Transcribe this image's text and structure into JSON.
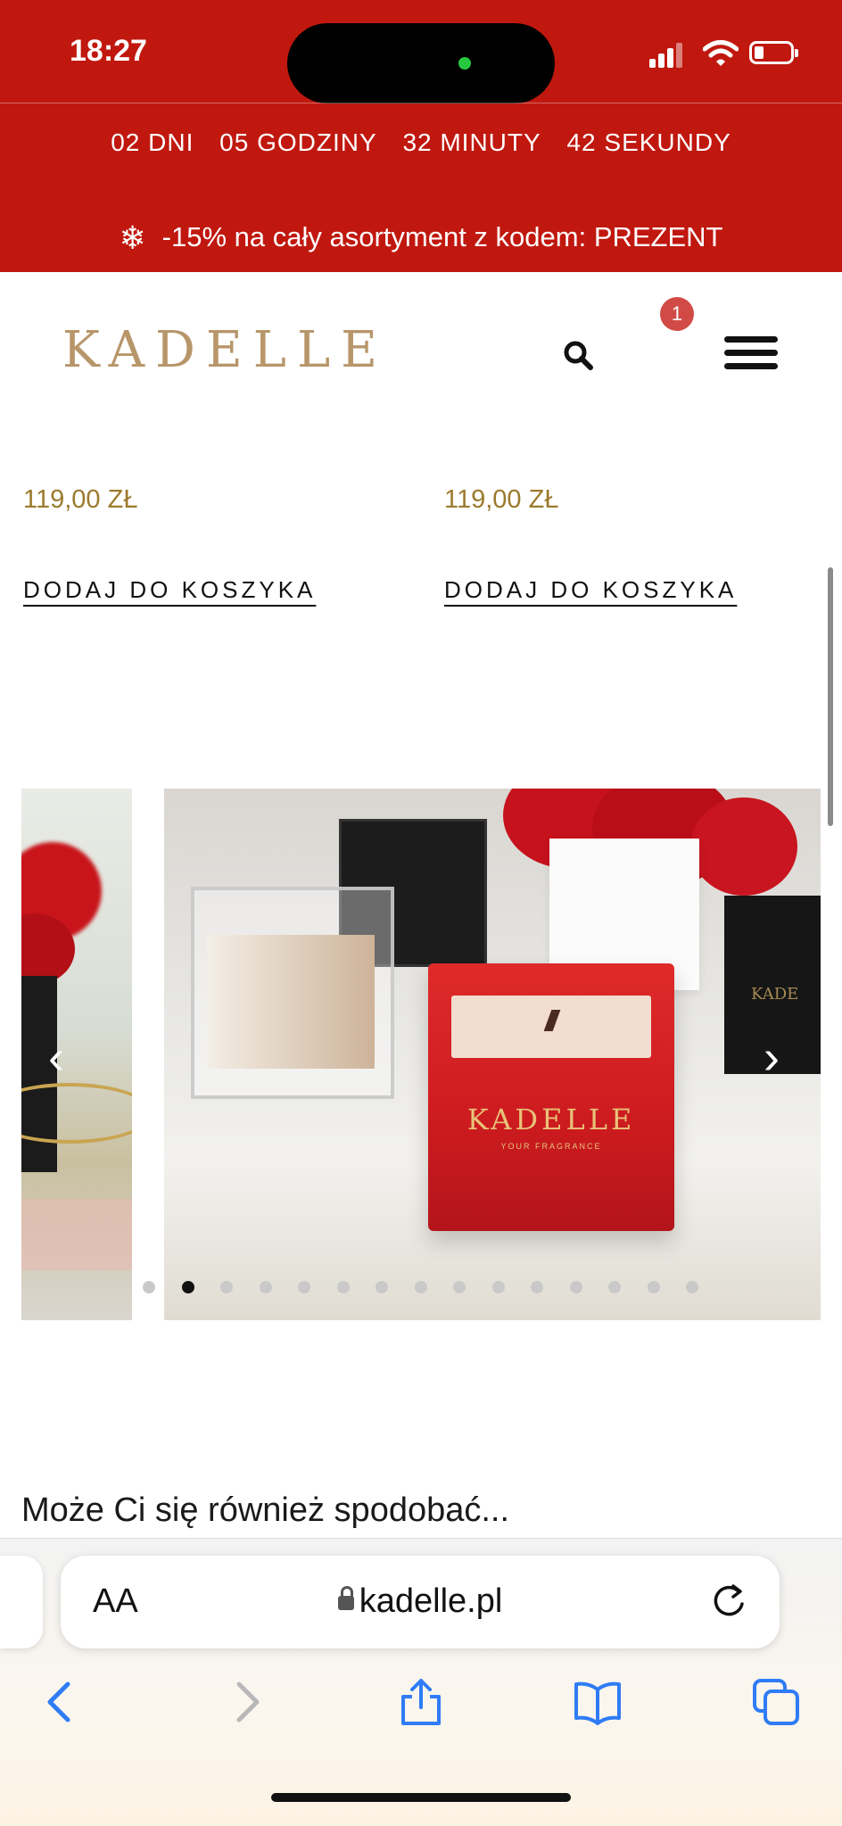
{
  "status_bar": {
    "time": "18:27",
    "icons": [
      "signal-icon",
      "wifi-icon",
      "battery-icon"
    ]
  },
  "countdown": {
    "days": "02 DNI",
    "hours": "05 GODZINY",
    "minutes": "32 MINUTY",
    "seconds": "42 SEKUNDY"
  },
  "promo": {
    "icon": "snowflake-icon",
    "text": "-15% na cały asortyment z kodem: PREZENT"
  },
  "header": {
    "logo": "KADELLE",
    "cart_count": "1",
    "icons": [
      "search-icon",
      "menu-icon"
    ]
  },
  "products": [
    {
      "price": "119,00 ZŁ",
      "add_to_cart": "DODAJ DO KOSZYKA"
    },
    {
      "price": "119,00 ZŁ",
      "add_to_cart": "DODAJ DO KOSZYKA"
    }
  ],
  "slider": {
    "prev_icon": "chevron-left-icon",
    "next_icon": "chevron-right-icon",
    "candle_label": "KADELLE",
    "candle_sublabel": "YOUR FRAGRANCE",
    "dot_count": 15,
    "active_dot": 1
  },
  "recommendations": {
    "title": "Może Ci się również spodobać..."
  },
  "browser": {
    "text_size_label": "AA",
    "url": "kadelle.pl",
    "toolbar_icons": [
      "back-icon",
      "forward-icon",
      "share-icon",
      "bookmarks-icon",
      "tabs-icon"
    ]
  },
  "colors": {
    "promo_red": "#c0180f",
    "gold": "#b7966a",
    "price_gold": "#9c7a2d",
    "badge_red": "#d24a45",
    "safari_blue": "#2f7cf6"
  }
}
